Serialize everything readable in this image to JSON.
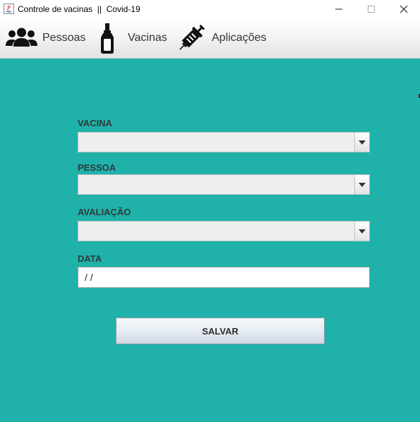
{
  "window": {
    "title": "Controle de vacinas  ||  Covid-19",
    "icons": [
      "java-icon",
      "minimize-icon",
      "maximize-icon",
      "close-icon"
    ]
  },
  "menu": {
    "items": [
      {
        "label": "Pessoas",
        "icon": "people-icon"
      },
      {
        "label": "Vacinas",
        "icon": "vaccine-vial-icon"
      },
      {
        "label": "Aplicações",
        "icon": "syringe-icon"
      }
    ]
  },
  "form": {
    "vacina_label": "VACINA",
    "vacina_value": "",
    "pessoa_label": "PESSOA",
    "pessoa_value": "",
    "avaliacao_label": "AVALIAÇÃO",
    "avaliacao_value": "",
    "data_label": "DATA",
    "data_value": " /  /",
    "save_label": "SALVAR"
  },
  "colors": {
    "background": "#20b2aa",
    "label": "#2d3b3b",
    "combo_bg": "#eeeeee"
  }
}
